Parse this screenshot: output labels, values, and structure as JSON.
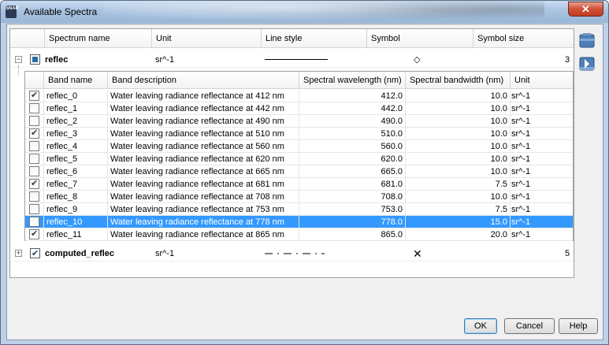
{
  "window": {
    "title": "Available Spectra",
    "close_label": "✕",
    "app_icon_text": "SNAP"
  },
  "columns": [
    "Spectrum name",
    "Unit",
    "Line style",
    "Symbol",
    "Symbol size"
  ],
  "groups": [
    {
      "name": "reflec",
      "unit": "sr^-1",
      "symbol": "◇",
      "symbol_size": "3",
      "expander": "−",
      "checkbox": "partial"
    },
    {
      "name": "computed_reflec",
      "unit": "sr^-1",
      "symbol": "✕",
      "symbol_size": "5",
      "expander": "+",
      "checkbox": "checked"
    }
  ],
  "band_columns": [
    "Band name",
    "Band description",
    "Spectral wavelength (nm)",
    "Spectral bandwidth (nm)",
    "Unit"
  ],
  "bands": [
    {
      "name": "reflec_0",
      "desc": "Water leaving radiance reflectance at 412 nm",
      "wl": "412.0",
      "bw": "10.0",
      "unit": "sr^-1",
      "checked": true
    },
    {
      "name": "reflec_1",
      "desc": "Water leaving radiance reflectance at 442 nm",
      "wl": "442.0",
      "bw": "10.0",
      "unit": "sr^-1",
      "checked": false
    },
    {
      "name": "reflec_2",
      "desc": "Water leaving radiance reflectance at 490 nm",
      "wl": "490.0",
      "bw": "10.0",
      "unit": "sr^-1",
      "checked": false
    },
    {
      "name": "reflec_3",
      "desc": "Water leaving radiance reflectance at 510 nm",
      "wl": "510.0",
      "bw": "10.0",
      "unit": "sr^-1",
      "checked": true
    },
    {
      "name": "reflec_4",
      "desc": "Water leaving radiance reflectance at 560 nm",
      "wl": "560.0",
      "bw": "10.0",
      "unit": "sr^-1",
      "checked": false
    },
    {
      "name": "reflec_5",
      "desc": "Water leaving radiance reflectance at 620 nm",
      "wl": "620.0",
      "bw": "10.0",
      "unit": "sr^-1",
      "checked": false
    },
    {
      "name": "reflec_6",
      "desc": "Water leaving radiance reflectance at 665 nm",
      "wl": "665.0",
      "bw": "10.0",
      "unit": "sr^-1",
      "checked": false
    },
    {
      "name": "reflec_7",
      "desc": "Water leaving radiance reflectance at 681 nm",
      "wl": "681.0",
      "bw": "7.5",
      "unit": "sr^-1",
      "checked": true
    },
    {
      "name": "reflec_8",
      "desc": "Water leaving radiance reflectance at 708 nm",
      "wl": "708.0",
      "bw": "10.0",
      "unit": "sr^-1",
      "checked": false
    },
    {
      "name": "reflec_9",
      "desc": "Water leaving radiance reflectance at 753 nm",
      "wl": "753.0",
      "bw": "7.5",
      "unit": "sr^-1",
      "checked": false
    },
    {
      "name": "reflec_10",
      "desc": "Water leaving radiance reflectance at 778 nm",
      "wl": "778.0",
      "bw": "15.0",
      "unit": "sr^-1",
      "checked": false,
      "selected": true
    },
    {
      "name": "reflec_11",
      "desc": "Water leaving radiance reflectance at 865 nm",
      "wl": "865.0",
      "bw": "20.0",
      "unit": "sr^-1",
      "checked": true
    }
  ],
  "side_buttons": [
    "open-file-icon",
    "save-file-icon"
  ],
  "buttons": {
    "ok": "OK",
    "cancel": "Cancel",
    "help": "Help"
  },
  "colors": {
    "selection": "#3399ff",
    "partial_check": "#2a6aa6"
  }
}
